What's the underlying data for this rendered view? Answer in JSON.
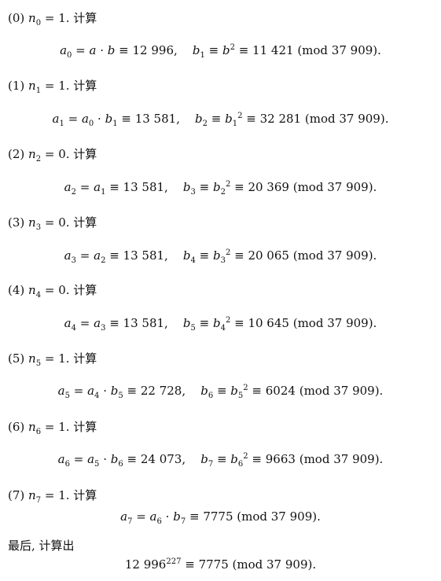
{
  "steps": [
    {
      "label": "(0)",
      "n_index": "0",
      "n_value": "1",
      "compute": "计算",
      "a_index": "0",
      "a_expr_main": "a",
      "a_expr_op": "·",
      "a_expr_b": "b",
      "a_expr_b_index": "",
      "a_value": "12 996",
      "b_index": "1",
      "b_base": "b",
      "b_base_index": "",
      "b_value": "11 421",
      "mod": "(mod 37 909)."
    },
    {
      "label": "(1)",
      "n_index": "1",
      "n_value": "1",
      "compute": "计算",
      "a_index": "1",
      "a_expr_main": "a",
      "a_expr_main_index": "0",
      "a_expr_op": "·",
      "a_expr_b": "b",
      "a_expr_b_index": "1",
      "a_value": "13 581",
      "b_index": "2",
      "b_base": "b",
      "b_base_index": "1",
      "b_value": "32 281",
      "mod": "(mod 37 909)."
    },
    {
      "label": "(2)",
      "n_index": "2",
      "n_value": "0",
      "compute": "计算",
      "a_index": "2",
      "a_expr_main": "a",
      "a_expr_main_index": "1",
      "a_value": "13 581",
      "b_index": "3",
      "b_base": "b",
      "b_base_index": "2",
      "b_value": "20 369",
      "mod": "(mod 37 909)."
    },
    {
      "label": "(3)",
      "n_index": "3",
      "n_value": "0",
      "compute": "计算",
      "a_index": "3",
      "a_expr_main": "a",
      "a_expr_main_index": "2",
      "a_value": "13 581",
      "b_index": "4",
      "b_base": "b",
      "b_base_index": "3",
      "b_value": "20 065",
      "mod": "(mod 37 909)."
    },
    {
      "label": "(4)",
      "n_index": "4",
      "n_value": "0",
      "compute": "计算",
      "a_index": "4",
      "a_expr_main": "a",
      "a_expr_main_index": "3",
      "a_value": "13 581",
      "b_index": "5",
      "b_base": "b",
      "b_base_index": "4",
      "b_value": "10 645",
      "mod": "(mod 37 909)."
    },
    {
      "label": "(5)",
      "n_index": "5",
      "n_value": "1",
      "compute": "计算",
      "a_index": "5",
      "a_expr_main": "a",
      "a_expr_main_index": "4",
      "a_expr_op": "·",
      "a_expr_b": "b",
      "a_expr_b_index": "5",
      "a_value": "22 728",
      "b_index": "6",
      "b_base": "b",
      "b_base_index": "5",
      "b_value": "6024",
      "mod": "(mod 37 909)."
    },
    {
      "label": "(6)",
      "n_index": "6",
      "n_value": "1",
      "compute": "计算",
      "a_index": "6",
      "a_expr_main": "a",
      "a_expr_main_index": "5",
      "a_expr_op": "·",
      "a_expr_b": "b",
      "a_expr_b_index": "6",
      "a_value": "24 073",
      "b_index": "7",
      "b_base": "b",
      "b_base_index": "6",
      "b_value": "9663",
      "mod": "(mod 37 909)."
    },
    {
      "label": "(7)",
      "n_index": "7",
      "n_value": "1",
      "compute": "计算",
      "a_index": "7",
      "a_expr_main": "a",
      "a_expr_main_index": "6",
      "a_expr_op": "·",
      "a_expr_b": "b",
      "a_expr_b_index": "7",
      "a_value": "7775",
      "mod": "(mod 37 909)."
    }
  ],
  "final": {
    "intro": "最后, 计算出",
    "base": "12 996",
    "exponent": "227",
    "result": "7775",
    "mod": "(mod 37 909)."
  }
}
